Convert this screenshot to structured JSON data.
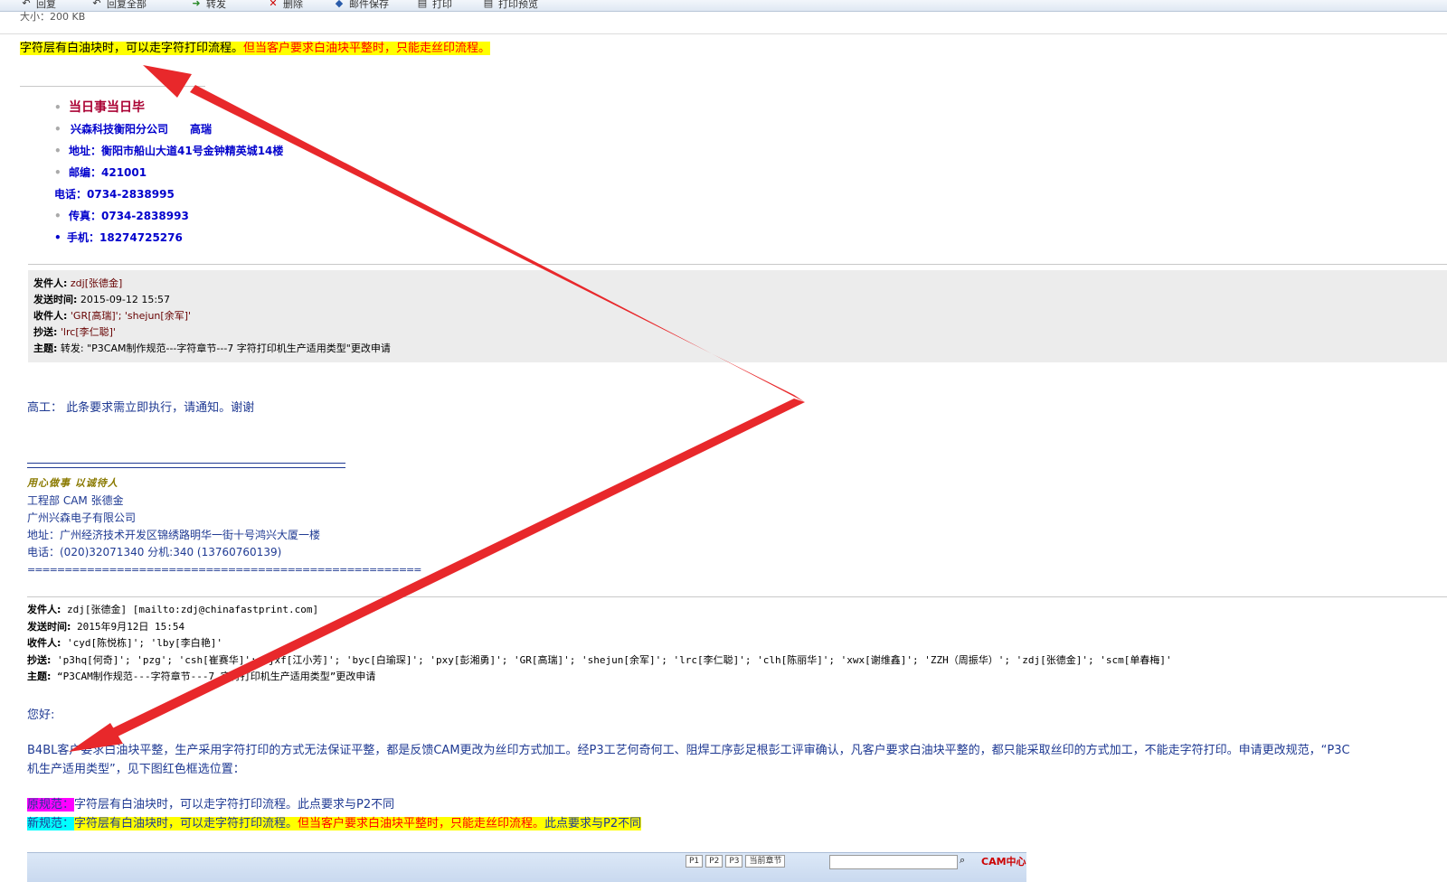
{
  "toolbar": {
    "reply": "回复",
    "reply_all": "回复全部",
    "forward": "转发",
    "delete": "删除",
    "save": "邮件保存",
    "print": "打印",
    "print_preview": "打印预览"
  },
  "attachment_size": "大小：200 KB",
  "top_note": {
    "part1": "字符层有白油块时，可以走字符打印流程。",
    "part2": "但当客户要求白油块平整时，只能走丝印流程。"
  },
  "signature1": {
    "motto": "当日事当日毕",
    "company": "兴森科技衡阳分公司　　高瑞",
    "address": "地址：衡阳市船山大道41号金钟精英城14楼",
    "postcode": "邮编：421001",
    "phone": "电话：0734-2838995",
    "fax": "传真：0734-2838993",
    "mobile": "手机：18274725276"
  },
  "header1": {
    "from_label": "发件人:",
    "from": "zdj[张德金]",
    "sent_label": "发送时间:",
    "sent": "2015-09-12 15:57",
    "to_label": "收件人:",
    "to": "'GR[高瑞]'; 'shejun[余军]'",
    "cc_label": "抄送:",
    "cc": "'lrc[李仁聪]'",
    "subject_label": "主题:",
    "subject": "转发: \"P3CAM制作规范---字符章节---7 字符打印机生产适用类型\"更改申请"
  },
  "gaogong": "高工：  此条要求需立即执行，请通知。谢谢",
  "signature2": {
    "motto": "用心做事  以诚待人",
    "dept": "工程部  CAM  张德金",
    "company": "广州兴森电子有限公司",
    "address": "地址：广州经济技术开发区锦绣路明华一街十号鸿兴大厦一楼",
    "phone": "电话：(020)32071340 分机:340 (13760760139)",
    "rule": "====================================================="
  },
  "header2": {
    "from_label": "发件人:",
    "from": " zdj[张德金] [mailto:zdj@chinafastprint.com]",
    "sent_label": "发送时间:",
    "sent": " 2015年9月12日 15:54",
    "to_label": "收件人:",
    "to": " 'cyd[陈悦栋]'; 'lby[李白艳]'",
    "cc_label": "抄送:",
    "cc": " 'p3hq[何奇]'; 'pzg'; 'csh[崔赛华]'; 'jxf[江小芳]'; 'byc[白瑜琛]'; 'pxy[彭湘勇]'; 'GR[高瑞]'; 'shejun[余军]'; 'lrc[李仁聪]'; 'clh[陈丽华]'; 'xwx[谢维鑫]'; 'ZZH（周振华）'; 'zdj[张德金]'; 'scm[单春梅]'",
    "subject_label": "主题:",
    "subject": " “P3CAM制作规范---字符章节---7 字符打印机生产适用类型”更改申请"
  },
  "greeting": "您好:",
  "body": {
    "line1": "B4BL客户要求白油块平整，生产采用字符打印的方式无法保证平整，都是反馈CAM更改为丝印方式加工。经P3工艺何奇何工、阻焊工序彭足根彭工评审确认，凡客户要求白油块平整的，都只能采取丝印的方式加工，不能走字符打印。申请更改规范，“P3C",
    "line2": "机生产适用类型”，见下图红色框选位置："
  },
  "old_spec": {
    "label": "原规范：",
    "text": "字符层有白油块时，可以走字符打印流程。此点要求与P2不同"
  },
  "new_spec": {
    "label": "新规范：",
    "text1": "字符层有白油块时，可以走字符打印流程。",
    "text2": "但当客户要求白油块平整时，只能走丝印流程。",
    "text3": "此点要求与P2不同"
  },
  "embedded_image": {
    "p1": "P1",
    "p2": "P2",
    "p3": "P3",
    "section": "当前章节",
    "brand": "CAM中心"
  },
  "colors": {
    "highlight_yellow": "#ffff00",
    "highlight_magenta": "#ff00ff",
    "highlight_cyan": "#00ffff",
    "text_red": "#ff0000",
    "text_blue": "#1f3a93",
    "arrow_red": "#e8282b"
  }
}
